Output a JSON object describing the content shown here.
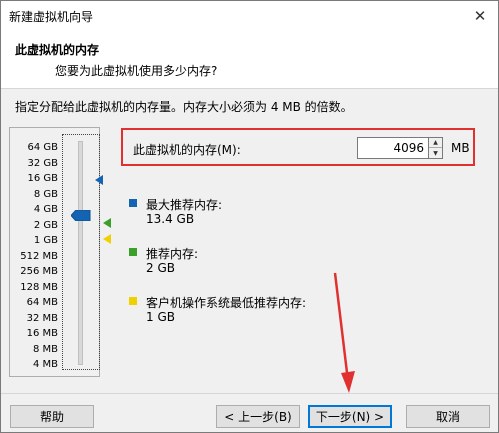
{
  "window": {
    "title": "新建虚拟机向导",
    "close_glyph": "✕"
  },
  "header": {
    "title": "此虚拟机的内存",
    "subtitle": "您要为此虚拟机使用多少内存?"
  },
  "instruction": "指定分配给此虚拟机的内存量。内存大小必须为 4 MB 的倍数。",
  "memory": {
    "label": "此虚拟机的内存(M):",
    "value": "4096",
    "unit": "MB",
    "spin_up": "▲",
    "spin_down": "▼"
  },
  "scale": {
    "labels": [
      "64 GB",
      "32 GB",
      "16 GB",
      "8 GB",
      "4 GB",
      "2 GB",
      "1 GB",
      "512 MB",
      "256 MB",
      "128 MB",
      "64 MB",
      "32 MB",
      "16 MB",
      "8 MB",
      "4 MB"
    ],
    "selected": "4 GB"
  },
  "legend": {
    "max": {
      "title": "最大推荐内存:",
      "value": "13.4 GB",
      "color": "#1464b4"
    },
    "recommended": {
      "title": "推荐内存:",
      "value": "2 GB",
      "color": "#3aa02a"
    },
    "min": {
      "title": "客户机操作系统最低推荐内存:",
      "value": "1 GB",
      "color": "#f0d000"
    }
  },
  "footer": {
    "help": "帮助",
    "back": "< 上一步(B)",
    "next": "下一步(N) >",
    "cancel": "取消"
  },
  "accent_color": "#0078d7",
  "annotation_color": "#e03030"
}
